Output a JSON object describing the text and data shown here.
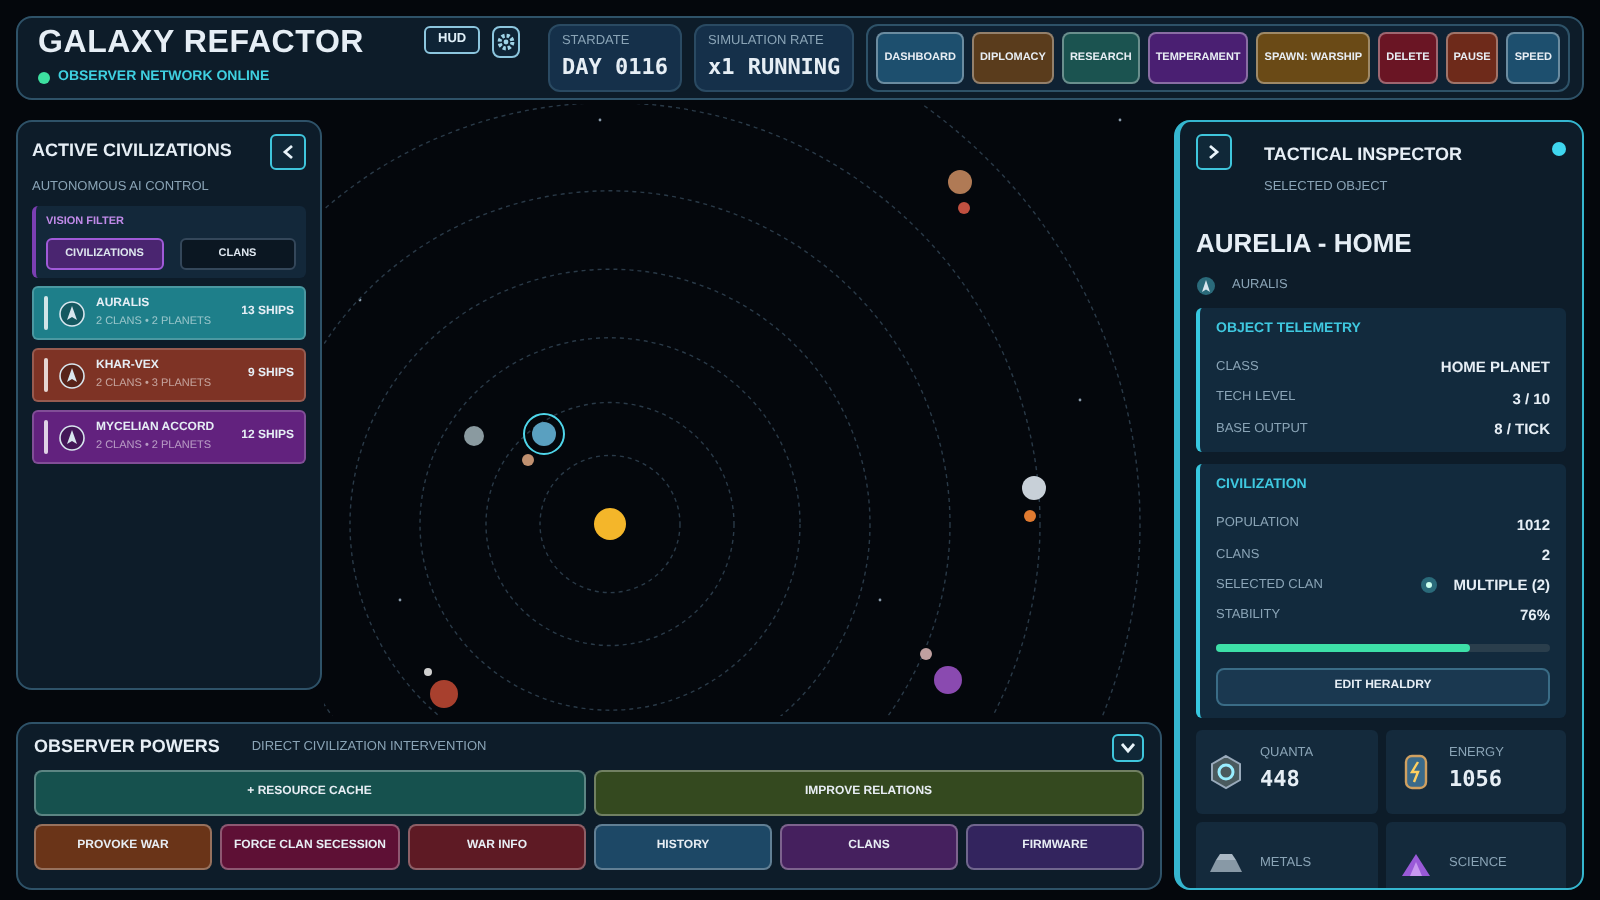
{
  "header": {
    "title": "GALAXY REFACTOR",
    "hud_button": "HUD",
    "status": "OBSERVER NETWORK ONLINE",
    "stats": [
      {
        "label": "STARDATE",
        "value": "DAY 0116"
      },
      {
        "label": "SIMULATION RATE",
        "value": "x1 RUNNING"
      }
    ],
    "buttons": [
      {
        "label": "DASHBOARD",
        "color": "#1d4f6e"
      },
      {
        "label": "DIPLOMACY",
        "color": "#5a3c1c"
      },
      {
        "label": "RESEARCH",
        "color": "#1b5350"
      },
      {
        "label": "TEMPERAMENT",
        "color": "#4a1f72"
      },
      {
        "label": "SPAWN: WARSHIP",
        "color": "#6a4a16"
      },
      {
        "label": "DELETE",
        "color": "#6a1524"
      },
      {
        "label": "PAUSE",
        "color": "#6e2a1a"
      },
      {
        "label": "SPEED",
        "color": "#1d4f6e"
      }
    ]
  },
  "civ_panel": {
    "title": "ACTIVE CIVILIZATIONS",
    "subtitle": "AUTONOMOUS AI CONTROL",
    "filter": {
      "label": "VISION FILTER",
      "tabs": [
        {
          "label": "CIVILIZATIONS",
          "selected": true
        },
        {
          "label": "CLANS",
          "selected": false
        }
      ]
    },
    "civilizations": [
      {
        "name": "AURALIS",
        "detail": "2 CLANS • 2 PLANETS",
        "ships": "13 SHIPS",
        "color": "#1e7f8a"
      },
      {
        "name": "KHAR-VEX",
        "detail": "2 CLANS • 3 PLANETS",
        "ships": "9 SHIPS",
        "color": "#7e3325"
      },
      {
        "name": "MYCELIAN ACCORD",
        "detail": "2 CLANS • 2 PLANETS",
        "ships": "12 SHIPS",
        "color": "#62227e"
      }
    ]
  },
  "powers": {
    "title": "OBSERVER POWERS",
    "subtitle": "DIRECT CIVILIZATION INTERVENTION",
    "primary_actions": [
      {
        "label": "+ RESOURCE CACHE",
        "color": "#16514e"
      },
      {
        "label": "IMPROVE RELATIONS",
        "color": "#34491f"
      }
    ],
    "actions": [
      {
        "label": "PROVOKE WAR",
        "color": "#6a3418"
      },
      {
        "label": "FORCE CLAN SECESSION",
        "color": "#5e1035"
      },
      {
        "label": "WAR INFO",
        "color": "#5e1a24"
      },
      {
        "label": "HISTORY",
        "color": "#1d4866"
      },
      {
        "label": "CLANS",
        "color": "#45205e"
      },
      {
        "label": "FIRMWARE",
        "color": "#33245e"
      }
    ]
  },
  "inspector": {
    "title": "TACTICAL INSPECTOR",
    "subtitle": "SELECTED OBJECT",
    "object_name": "AURELIA - HOME",
    "owner": "AURALIS",
    "telemetry": {
      "title": "OBJECT TELEMETRY",
      "rows": [
        {
          "label": "CLASS",
          "value": "HOME PLANET"
        },
        {
          "label": "TECH LEVEL",
          "value": "3 / 10"
        },
        {
          "label": "BASE OUTPUT",
          "value": "8 / TICK"
        }
      ]
    },
    "civilization": {
      "title": "CIVILIZATION",
      "rows": [
        {
          "label": "POPULATION",
          "value": "1012",
          "kind": "plain"
        },
        {
          "label": "CLANS",
          "value": "2",
          "kind": "plain"
        },
        {
          "label": "SELECTED CLAN",
          "value": "MULTIPLE (2)",
          "kind": "emblem"
        },
        {
          "label": "STABILITY",
          "value": "76%",
          "kind": "plain"
        }
      ],
      "stability": {
        "level": 0.76
      },
      "button": "EDIT HERALDRY"
    },
    "resources": [
      {
        "label": "QUANTA",
        "value": "448",
        "kind": "quanta"
      },
      {
        "label": "ENERGY",
        "value": "1056",
        "kind": "energy"
      },
      {
        "label": "METALS",
        "kind": "metals"
      },
      {
        "label": "SCIENCE",
        "kind": "science"
      }
    ]
  }
}
